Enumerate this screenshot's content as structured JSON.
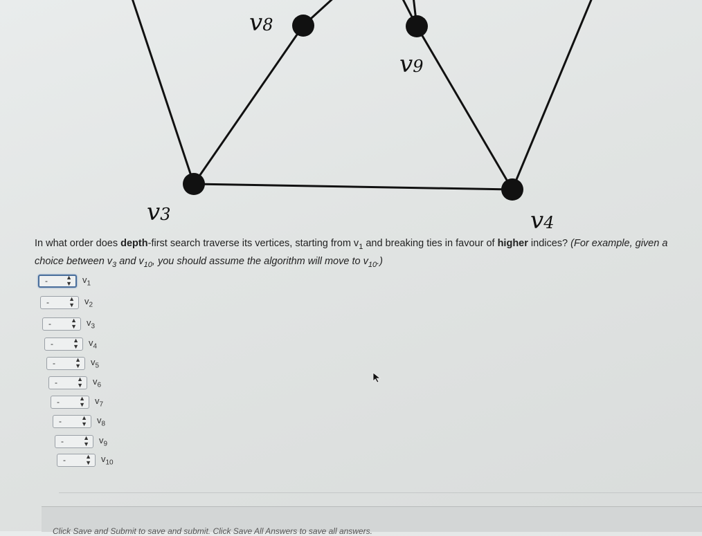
{
  "graph": {
    "vertices": {
      "v3": {
        "name": "v",
        "sub": "3"
      },
      "v4": {
        "name": "v",
        "sub": "4"
      },
      "v8": {
        "name": "v",
        "sub": "8"
      },
      "v9": {
        "name": "v",
        "sub": "9"
      }
    }
  },
  "question": {
    "part1": "In what order does ",
    "bold1": "depth",
    "part2": "-first search traverse its vertices, starting from v",
    "sub1": "1",
    "part3": " and breaking ties in favour of ",
    "bold2": "higher",
    "part4": " indices? ",
    "italic1": "(For example, given a choice between v",
    "sub2": "3",
    "italic2": " and v",
    "sub3": "10",
    "italic3": ", you should assume the algorithm will move to v",
    "sub4": "10",
    "italic4": ".)"
  },
  "answers": [
    {
      "value": "-",
      "vertex": "v",
      "sub": "1",
      "focused": true
    },
    {
      "value": "-",
      "vertex": "v",
      "sub": "2"
    },
    {
      "value": "-",
      "vertex": "v",
      "sub": "3"
    },
    {
      "value": "-",
      "vertex": "v",
      "sub": "4"
    },
    {
      "value": "-",
      "vertex": "v",
      "sub": "5"
    },
    {
      "value": "-",
      "vertex": "v",
      "sub": "6"
    },
    {
      "value": "-",
      "vertex": "v",
      "sub": "7"
    },
    {
      "value": "-",
      "vertex": "v",
      "sub": "8"
    },
    {
      "value": "-",
      "vertex": "v",
      "sub": "9"
    },
    {
      "value": "-",
      "vertex": "v",
      "sub": "10"
    }
  ],
  "footer": {
    "text": "Click Save and Submit to save and submit. Click Save All Answers to save all answers."
  },
  "icons": {
    "stepper": "up-down-arrows-icon",
    "cursor": "mouse-pointer-icon"
  }
}
